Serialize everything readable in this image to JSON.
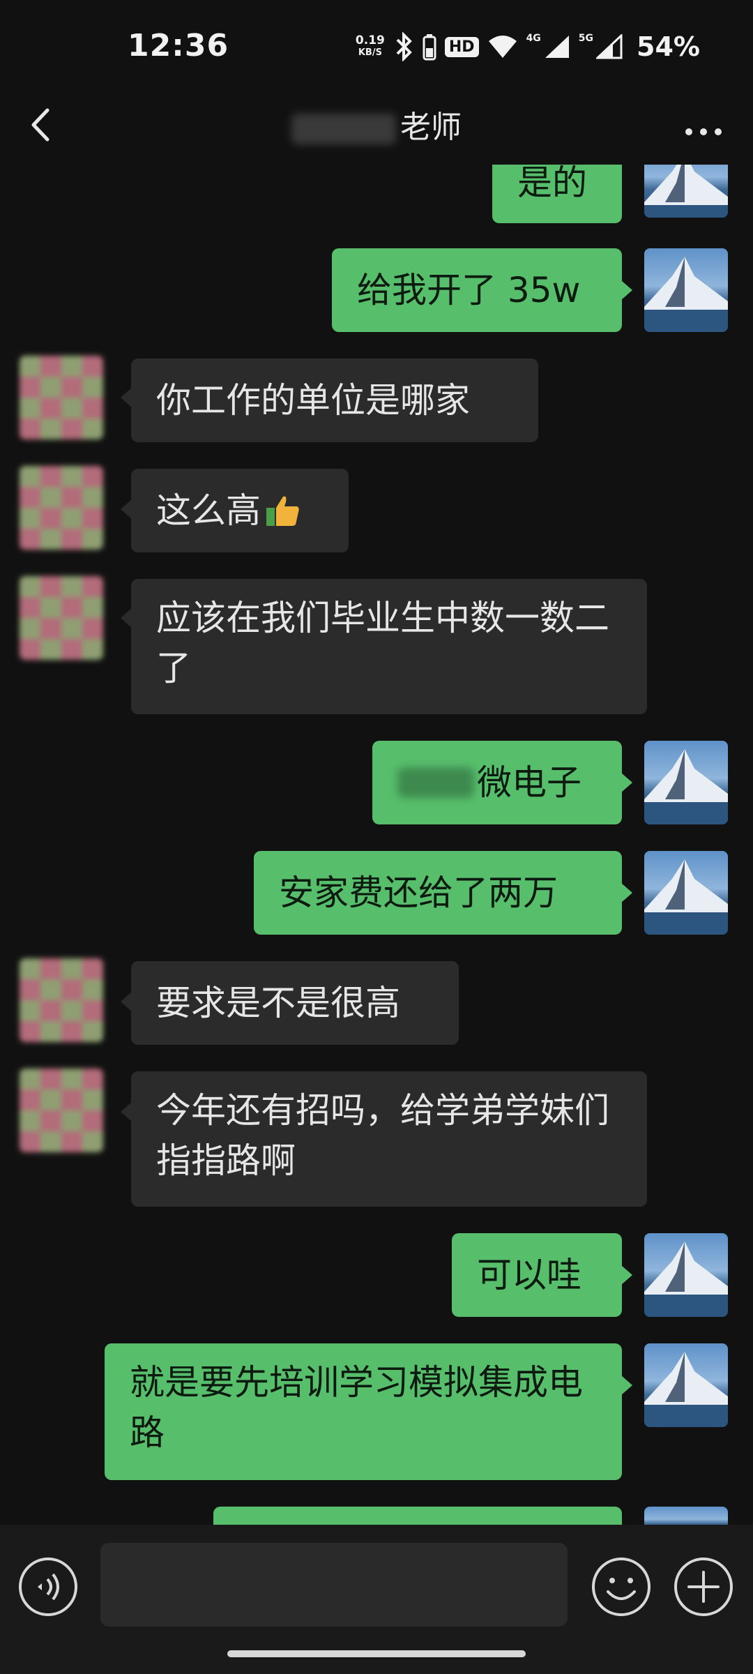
{
  "status_bar": {
    "time": "12:36",
    "net_speed_value": "0.19",
    "net_speed_unit": "KB/S",
    "hd_label": "HD",
    "network_1": "4G",
    "network_2": "5G",
    "battery": "54%"
  },
  "header": {
    "title": "老师"
  },
  "messages": [
    {
      "side": "me",
      "text": "是的"
    },
    {
      "side": "me",
      "text": "给我开了 35w"
    },
    {
      "side": "other",
      "text": "你工作的单位是哪家"
    },
    {
      "side": "other",
      "text": "这么高"
    },
    {
      "side": "other",
      "text": "应该在我们毕业生中数一数二了"
    },
    {
      "side": "me",
      "text": "微电子"
    },
    {
      "side": "me",
      "text": "安家费还给了两万"
    },
    {
      "side": "other",
      "text": "要求是不是很高"
    },
    {
      "side": "other",
      "text": "今年还有招吗，给学弟学妹们指指路啊"
    },
    {
      "side": "me",
      "text": "可以哇"
    },
    {
      "side": "me",
      "text": "就是要先培训学习模拟集成电路"
    },
    {
      "side": "me",
      "text": ""
    }
  ],
  "colors": {
    "background": "#111111",
    "my_bubble": "#57bf6c",
    "other_bubble": "#2b2b2b"
  },
  "icons": {
    "back": "chevron-left-icon",
    "more": "more-dots-icon",
    "voice": "voice-icon",
    "emoji": "emoji-icon",
    "plus": "plus-icon",
    "thumbs_up": "thumbs-up-icon"
  }
}
